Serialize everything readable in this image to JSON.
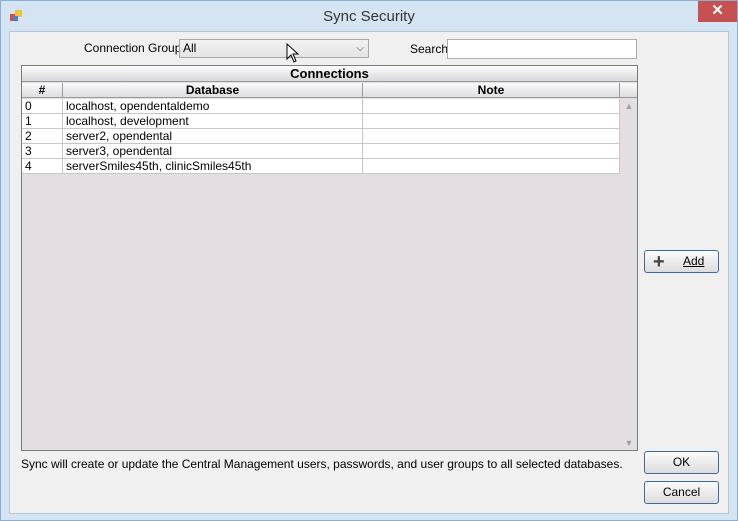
{
  "window": {
    "title": "Sync Security",
    "close_glyph": "✕"
  },
  "toolbar": {
    "connection_groups_label": "Connection Groups",
    "connection_groups_value": "All",
    "search_label": "Search",
    "search_value": ""
  },
  "grid": {
    "title": "Connections",
    "columns": [
      "#",
      "Database",
      "Note"
    ],
    "rows": [
      {
        "num": "0",
        "database": "localhost, opendentaldemo",
        "note": ""
      },
      {
        "num": "1",
        "database": "localhost, development",
        "note": ""
      },
      {
        "num": "2",
        "database": "server2, opendental",
        "note": ""
      },
      {
        "num": "3",
        "database": "server3, opendental",
        "note": ""
      },
      {
        "num": "4",
        "database": "serverSmiles45th, clinicSmiles45th",
        "note": ""
      }
    ]
  },
  "buttons": {
    "add": "Add",
    "ok": "OK",
    "cancel": "Cancel"
  },
  "footer_note": "Sync will create or update the Central Management users, passwords, and user groups to all selected databases.",
  "icons": {
    "app": "app-icon",
    "add": "plus-icon",
    "dropdown": "chevron-down-icon"
  }
}
